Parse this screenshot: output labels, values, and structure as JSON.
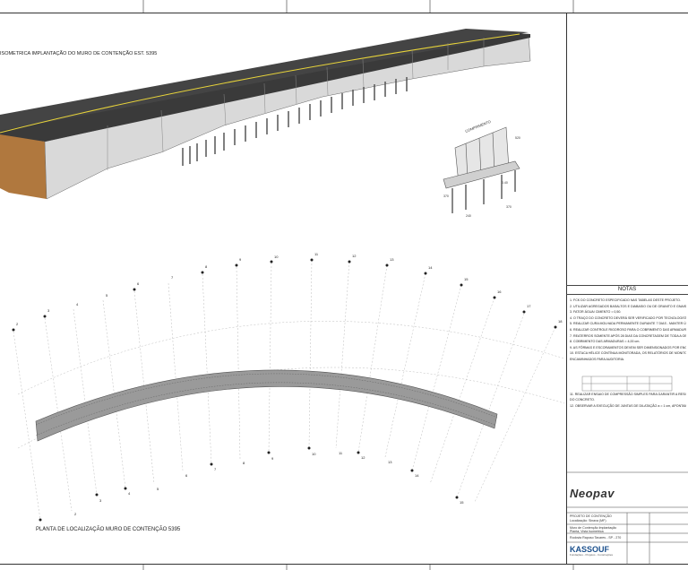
{
  "drawing": {
    "iso_title": "ISOMETRICA IMPLANTAÇÃO DO MURO DE CONTENÇÃO EST. 5395",
    "plan_title": "PLANTA DE LOCALIZAÇÃO MURO DE CONTENÇÃO 5395",
    "stations_top": [
      "2",
      "3",
      "4",
      "5",
      "6",
      "7",
      "8",
      "9",
      "10",
      "11",
      "12",
      "13",
      "14",
      "15",
      "16",
      "17",
      "18"
    ],
    "stations_bottom": [
      "1",
      "2",
      "3",
      "4",
      "5",
      "6",
      "7",
      "8",
      "9",
      "10",
      "11",
      "12",
      "13",
      "14",
      "15"
    ],
    "detail_label": "COMPRIMENTO",
    "dims": [
      "520",
      "0.40",
      "370",
      "240",
      "370"
    ]
  },
  "notes": {
    "title": "NOTAS",
    "items": [
      "1.  FCK DO CONCRETO ESPECIFICADO NAS TABELAS DESTE PROJETO.",
      "2.  UTILIZAR AGREGADOS BASALTOS E DIABASIO OU DE GRANITO E GNAISSE.",
      "3.  FATOR ÁGUA/ CIMENTO = 0,50.",
      "4.  O TRAÇO DO CONCRETO DEVERÁ SER VERIFICADO POR TECNOLOGISTA.",
      "5.  REALIZAR CURA MOLHADA PERMANENTE DURANTE 7 DIAS - MANTER ÚMIDO.",
      "6.  REALIZAR CONTROLE RIGOROSO PARA O COBRIMENTO DAS ARMADURAS.",
      "7.  REATERROS SOMENTE APÓS 28 DIAS DA CONCRETAGEM DE TODA A OBRA.",
      "8.  COBRIMENTO DAS ARMADURAS = 4,00 cm.",
      "9.  AS FÔRMAS E ESCORAMENTOS DEVEM SER DIMENSIONADOS POR ENGENHEIRO.",
      "10. ESTACA HÉLICE CONTÍNUA MONITORADA, OS RELATÓRIOS DE MONITORAMENTO",
      "     ENCAMINHADOS PARA AUDITORIA.",
      "11. REALIZAR ENSAIO DE COMPRESSÃO SIMPLES PARA GARANTIR A RESISTÊNCIA",
      "     DO CONCRETO.",
      "12. OBSERVAR A EXECUÇÃO DE JUNTAS DE DILATAÇÃO a = 1 cm,  APONTAMENTO"
    ]
  },
  "titleblock": {
    "brand": "Neopav",
    "project": "PROJETO DE CONTENÇÃO",
    "location": "Localização: Sinaxa (MF)",
    "content1": "Muro de Contenção Implantação",
    "content2": "Planta, Vista Isometrica",
    "road": "Rodovia Raposo Tavares - SP - 270",
    "company": "KASSOUF",
    "company_sub": "Fundações - Projetos - Construções"
  },
  "colors": {
    "asphalt": "#3a3a3a",
    "wall": "#d9d9d9",
    "soil": "#b0783e",
    "marking": "#e8d43a"
  }
}
